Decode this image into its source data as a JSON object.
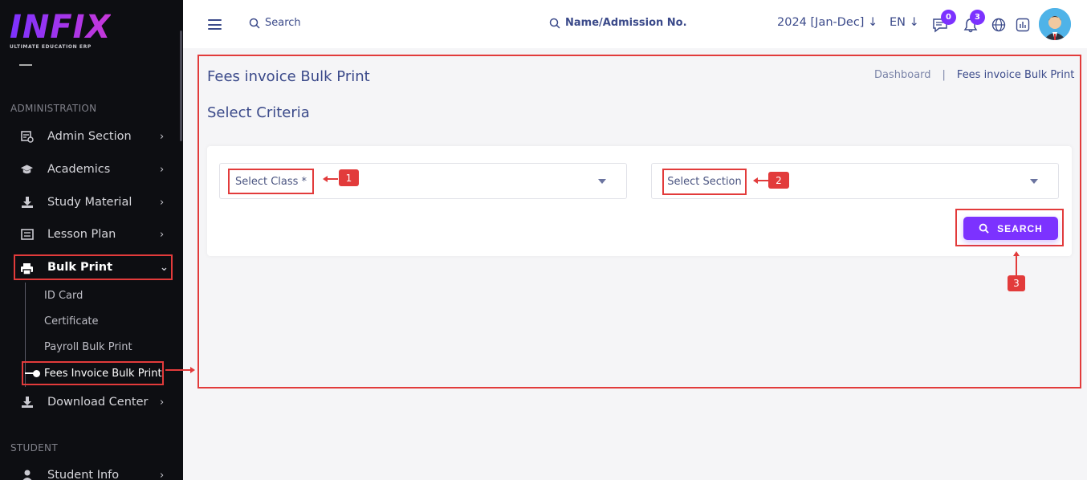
{
  "brand": {
    "logo": "INFIX",
    "tagline": "ULTIMATE EDUCATION ERP"
  },
  "sidebar": {
    "sections": [
      "ADMINISTRATION",
      "STUDENT"
    ],
    "items": [
      {
        "label": "Admin Section",
        "icon": "admin-icon"
      },
      {
        "label": "Academics",
        "icon": "graduation-cap-icon"
      },
      {
        "label": "Study Material",
        "icon": "download-icon"
      },
      {
        "label": "Lesson Plan",
        "icon": "list-icon"
      },
      {
        "label": "Bulk Print",
        "icon": "printer-icon",
        "active": true
      },
      {
        "label": "Download Center",
        "icon": "download-icon"
      },
      {
        "label": "Student Info",
        "icon": "user-icon"
      }
    ],
    "subitems": [
      "ID Card",
      "Certificate",
      "Payroll Bulk Print",
      "Fees Invoice Bulk Print"
    ]
  },
  "topbar": {
    "search_label": "Search",
    "admission_search_label": "Name/Admission No.",
    "session": "2024 [Jan-Dec]",
    "language": "EN",
    "message_count": "0",
    "notification_count": "3"
  },
  "page": {
    "title": "Fees invoice Bulk Print",
    "breadcrumb": [
      "Dashboard",
      "|",
      "Fees invoice Bulk Print"
    ],
    "criteria_title": "Select Criteria",
    "class_placeholder": "Select Class *",
    "section_placeholder": "Select Section",
    "search_button": "SEARCH"
  },
  "annotations": [
    "1",
    "2",
    "3"
  ],
  "colors": {
    "accent": "#7c32ff",
    "highlight": "#e23b3b",
    "sidebar": "#0d0e12"
  }
}
